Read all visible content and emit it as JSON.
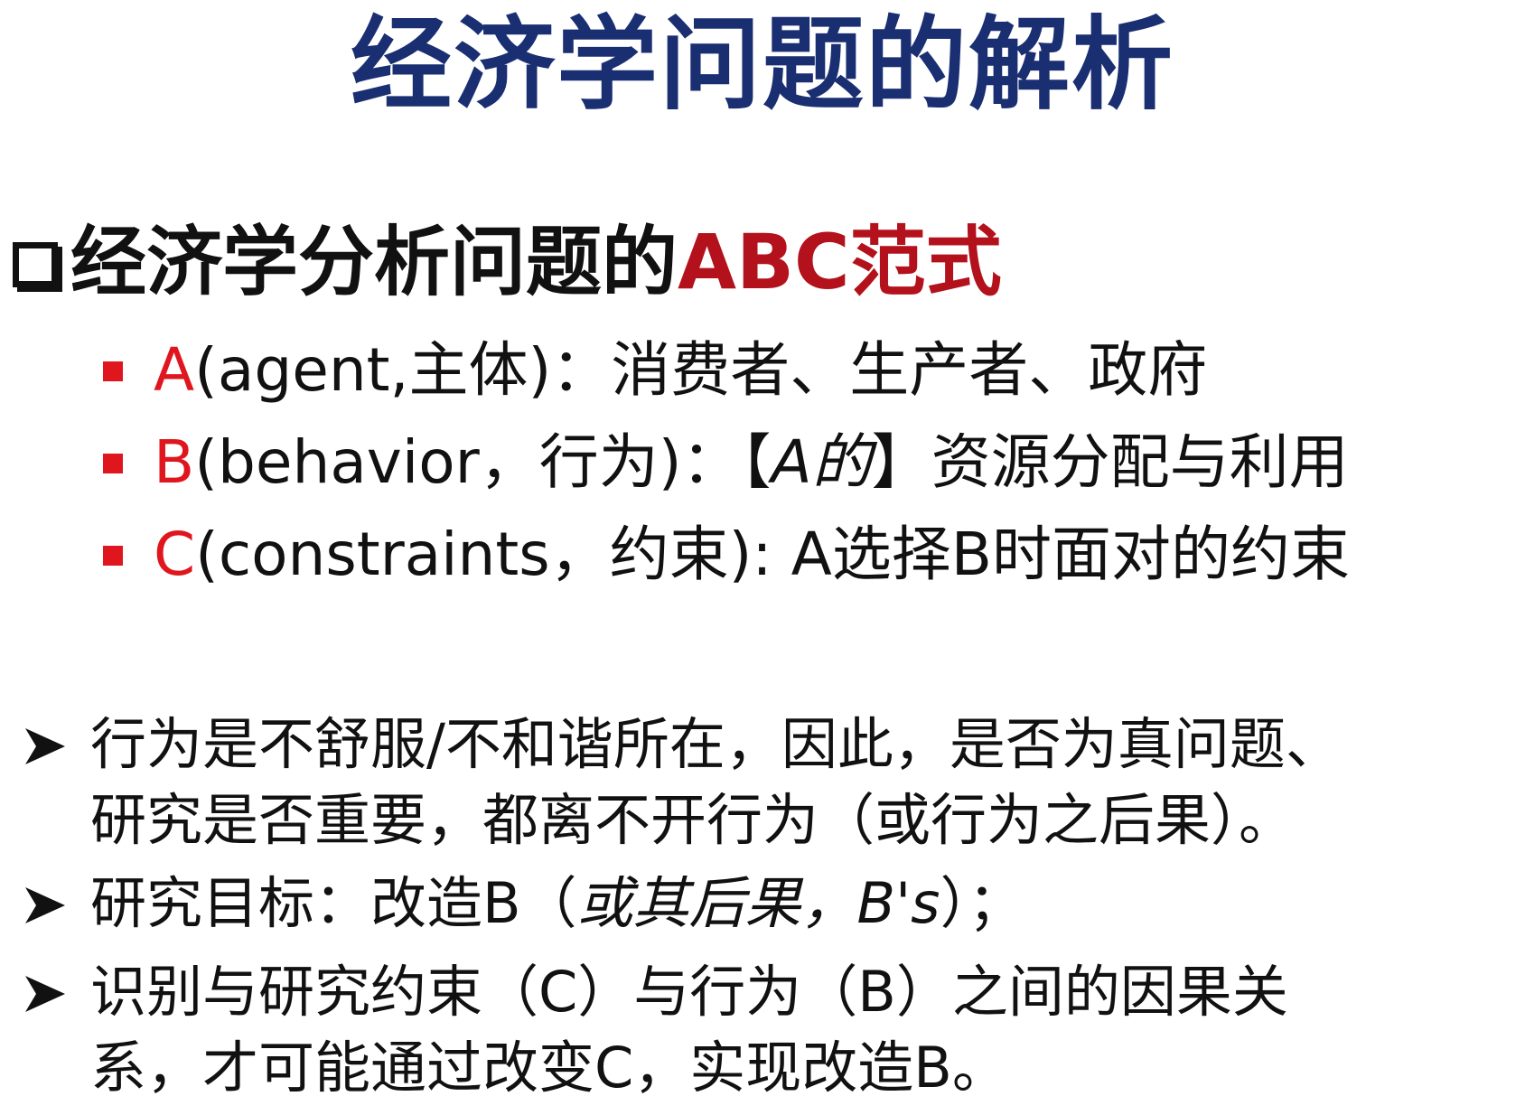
{
  "title": "经济学问题的解析",
  "heading": {
    "prefix": "经济学分析问题的",
    "highlight": "ABC范式"
  },
  "abc_items": [
    {
      "letter": "A",
      "text": "(agent,主体)：消费者、生产者、政府"
    },
    {
      "letter": "B",
      "text_before": "(behavior，行为)：【",
      "text_italic": "A的",
      "text_after": "】资源分配与利用"
    },
    {
      "letter": "C",
      "text": "(constraints，约束): A选择B时面对的约束"
    }
  ],
  "points": [
    {
      "lines": [
        "行为是不舒服/不和谐所在，因此，是否为真问题、",
        "研究是否重要，都离不开行为（或行为之后果）。"
      ]
    },
    {
      "before": "研究目标：改造B（",
      "italic": "或其后果，B's",
      "after": "）；"
    },
    {
      "lines": [
        "识别与研究约束（C）与行为（B）之间的因果关",
        "系，才可能通过改变C，实现改造B。"
      ]
    }
  ],
  "colors": {
    "title": "#1a2e72",
    "accent_red": "#b3111c",
    "bullet_red": "#e0161f",
    "text": "#111111"
  },
  "icons": {
    "heading_bullet": "hollow-square-icon",
    "list_bullet": "red-square-icon",
    "point_bullet": "arrowhead-icon"
  }
}
